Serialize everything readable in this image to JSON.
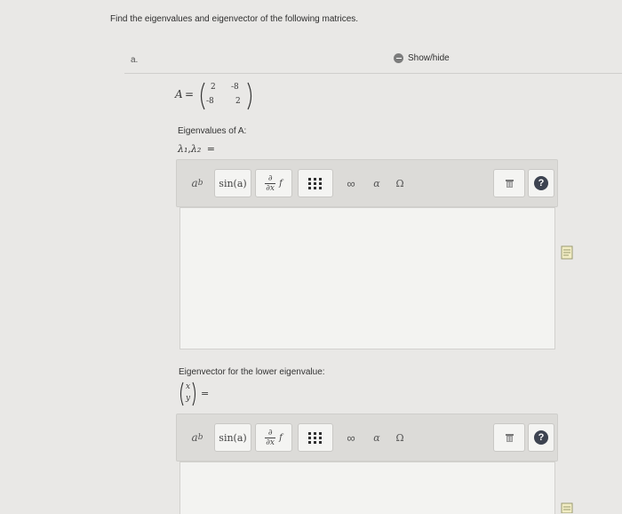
{
  "question": {
    "prompt": "Find the eigenvalues and eigenvector of the following matrices."
  },
  "part": {
    "label": "a.",
    "show_hide": "Show/hide"
  },
  "matrix": {
    "name": "A",
    "equals": "=",
    "rows": [
      [
        "2",
        "-8"
      ],
      [
        "-8",
        "2"
      ]
    ]
  },
  "eigenvalues": {
    "label": "Eigenvalues of A:",
    "lambda1": "λ₁",
    "separator": ",",
    "lambda2": "λ₂",
    "equals": "="
  },
  "toolbar": {
    "power": "a",
    "power_exp": "b",
    "sin": "sin(a)",
    "deriv_num": "∂",
    "deriv_den": "∂x",
    "deriv_f": "f",
    "infinity": "∞",
    "alpha": "α",
    "omega": "Ω",
    "help": "?"
  },
  "eigenvector": {
    "label": "Eigenvector for the lower eigenvalue:",
    "x": "x",
    "y": "y",
    "equals": "="
  }
}
